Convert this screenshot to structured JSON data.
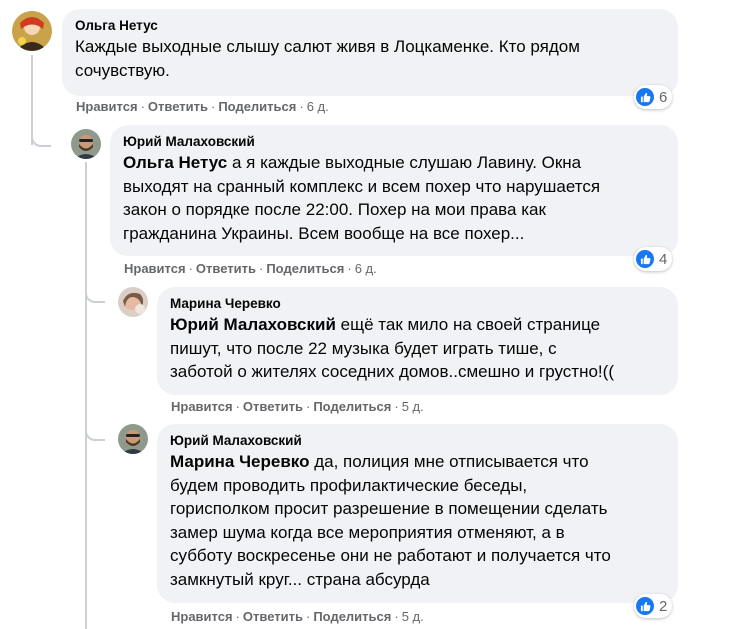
{
  "colors": {
    "like_blue": "#1877f2",
    "bubble_bg": "#f0f2f5",
    "meta_gray": "#65676b"
  },
  "actions": {
    "like": "Нравится",
    "reply": "Ответить",
    "share": "Поделиться",
    "separator": "·"
  },
  "comments": [
    {
      "author": "Ольга Нетус",
      "mention": "",
      "text_lines": [
        "Каждые выходные слышу салют живя в Лоцкаменке. Кто рядом",
        "сочувствую."
      ],
      "time": "6 д.",
      "likes": "6"
    },
    {
      "author": "Юрий Малаховский",
      "mention": "Ольга Нетус",
      "text_lines": [
        " а я каждые выходные слушаю Лавину. Окна",
        "выходят на сранный комплекс и всем похер что нарушается",
        "закон о порядке после 22:00. Похер на мои права как",
        "гражданина Украины. Всем вообще на все похер..."
      ],
      "time": "6 д.",
      "likes": "4"
    },
    {
      "author": "Марина Черевко",
      "mention": "Юрий Малаховский",
      "text_lines": [
        " ещё так мило на своей странице",
        "пишут, что после 22 музыка будет играть тише, с",
        "заботой о жителях соседних домов..смешно и грустно!(("
      ],
      "time": "5 д.",
      "likes": ""
    },
    {
      "author": "Юрий Малаховский",
      "mention": "Марина Черевко",
      "text_lines": [
        " да, полиция мне отписывается что",
        "будем проводить профилактические беседы,",
        "горисполком просит разрешение в помещении сделать",
        "замер шума когда все мероприятия отменяют, а в",
        "субботу воскресенье они не работают и получается что",
        "замкнутый круг... страна абсурда"
      ],
      "time": "5 д.",
      "likes": "2"
    }
  ]
}
